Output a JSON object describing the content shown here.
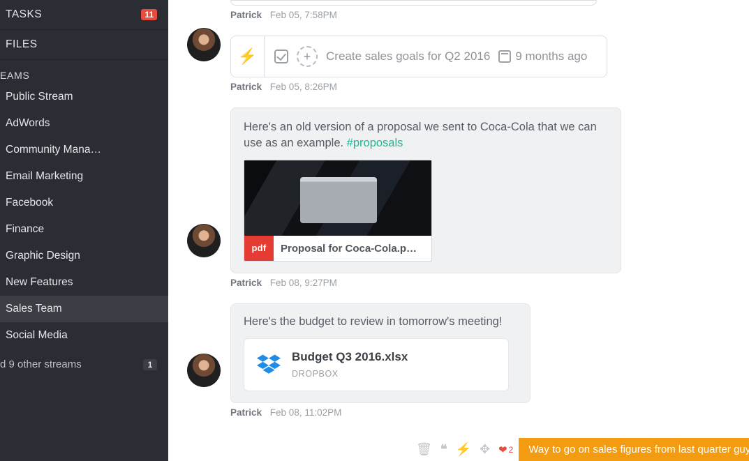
{
  "sidebar": {
    "tasks_label": "TASKS",
    "tasks_count": "11",
    "files_label": "FILES",
    "teams_heading": "EAMS",
    "streams": [
      "Public Stream",
      "AdWords",
      "Community Mana…",
      "Email Marketing",
      "Facebook",
      "Finance",
      "Graphic Design",
      "New Features",
      "Sales Team",
      "Social Media"
    ],
    "selected_stream_index": 8,
    "footer_text": "d 9 other streams",
    "footer_badge": "1"
  },
  "feed": {
    "posts": [
      {
        "author": "Patrick",
        "timestamp": "Feb 05, 7:58PM"
      },
      {
        "author": "Patrick",
        "timestamp": "Feb 05, 8:26PM",
        "task": {
          "title": "Create sales goals for Q2 2016",
          "relative_time": "9 months ago"
        }
      },
      {
        "author": "Patrick",
        "timestamp": "Feb 08, 9:27PM",
        "message_prefix": "Here's an old version of a proposal we sent to Coca-Cola that we can use as an example. ",
        "hashtag": "#proposals",
        "attachment": {
          "badge": "pdf",
          "filename": "Proposal for Coca-Cola.p…"
        }
      },
      {
        "author": "Patrick",
        "timestamp": "Feb 08, 11:02PM",
        "message": "Here's the budget to review in tomorrow's meeting!",
        "dropbox": {
          "filename": "Budget Q3 2016.xlsx",
          "source": "DROPBOX"
        }
      }
    ]
  },
  "bottom": {
    "heart_count": "2",
    "notification": "Way to go on sales figures from last quarter guys! Crushed it!"
  }
}
